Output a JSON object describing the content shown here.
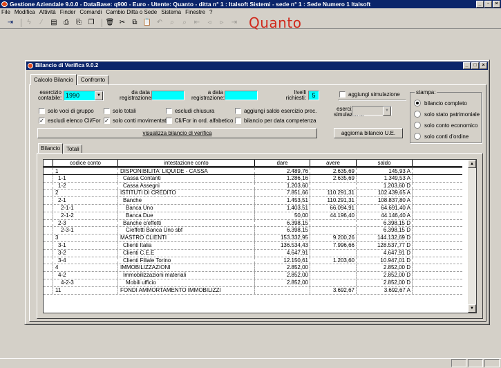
{
  "app": {
    "title": "Gestione Aziendale 9.0.0 - DataBase: q900 - Euro - Utente: Quanto - ditta n° 1 : Italsoft Sistemi - sede n° 1 : Sede Numero 1 Italsoft",
    "brand": "Quanto"
  },
  "menu": [
    "File",
    "Modifica",
    "Attività",
    "Finder",
    "Comandi",
    "Cambio Ditta o Sede",
    "Sistema",
    "Finestre",
    "?"
  ],
  "window": {
    "title": "Bilancio di Verifica 9.0.2",
    "tabs": [
      "Calcolo Bilancio",
      "Confronto"
    ]
  },
  "form": {
    "esercizio_label": "esercizio contabile:",
    "esercizio_value": "1990",
    "da_data_label": "da data registrazione:",
    "a_data_label": "a data registrazione:",
    "livelli_label": "livelli richiesti:",
    "livelli_value": "5",
    "aggiungi_simulazione": "aggiungi simulazione",
    "esercizio_di_simulazione": "esercizio di simulazione:",
    "stampa_label": "stampa:",
    "checkboxes": {
      "solo_voci_gruppo": "solo voci di gruppo",
      "solo_totali": "solo totali",
      "escludi_chiusura": "escludi chiusura",
      "aggiungi_saldo": "aggiungi saldo esercizio prec.",
      "escludi_elenco": "escludi elenco Cli/For",
      "solo_conti_movimentati": "solo conti movimentati",
      "cli_for_alfabetico": "Cli/For in ord. alfabetico",
      "bilancio_data_competenza": "bilancio per data competenza"
    },
    "radio": [
      "bilancio completo",
      "solo stato patrimoniale",
      "solo conto economico",
      "solo conti d'ordine"
    ],
    "visualizza_button": "visualizza bilancio di verifica",
    "aggiorna_button": "aggiorna bilancio U.E."
  },
  "subtabs": [
    "Bilancio",
    "Totali"
  ],
  "grid": {
    "columns": [
      "codice conto",
      "intestazione conto",
      "dare",
      "avere",
      "saldo"
    ],
    "rows": [
      {
        "codice": "1",
        "intestazione": "DISPONIBILITA' LIQUIDE - CASSA",
        "dare": "2.489,76",
        "avere": "2.635,69",
        "saldo": "145,93 A"
      },
      {
        "codice": "1-1",
        "intestazione": "Cassa Contanti",
        "dare": "1.286,16",
        "avere": "2.635,69",
        "saldo": "1.349,53 A"
      },
      {
        "codice": "1-2",
        "intestazione": "Cassa Assegni",
        "dare": "1.203,60",
        "avere": "",
        "saldo": "1.203,60 D"
      },
      {
        "codice": "2",
        "intestazione": "ISTITUTI DI CREDITO",
        "dare": "7.851,66",
        "avere": "110.291,31",
        "saldo": "102.439,65 A"
      },
      {
        "codice": "2-1",
        "intestazione": "Banche",
        "dare": "1.453,51",
        "avere": "110.291,31",
        "saldo": "108.837,80 A"
      },
      {
        "codice": "2-1-1",
        "intestazione": "Banca Uno",
        "dare": "1.403,51",
        "avere": "66.094,91",
        "saldo": "64.691,40 A"
      },
      {
        "codice": "2-1-2",
        "intestazione": "Banca Due",
        "dare": "50,00",
        "avere": "44.196,40",
        "saldo": "44.146,40 A"
      },
      {
        "codice": "2-3",
        "intestazione": "Banche c/effetti",
        "dare": "6.398,15",
        "avere": "",
        "saldo": "6.398,15 D"
      },
      {
        "codice": "2-3-1",
        "intestazione": "C/effetti Banca Uno sbf",
        "dare": "6.398,15",
        "avere": "",
        "saldo": "6.398,15 D"
      },
      {
        "codice": "3",
        "intestazione": "MASTRO CLIENTI",
        "dare": "153.332,95",
        "avere": "9.200,26",
        "saldo": "144.132,69 D"
      },
      {
        "codice": "3-1",
        "intestazione": "Clienti Italia",
        "dare": "136.534,43",
        "avere": "7.996,66",
        "saldo": "128.537,77 D"
      },
      {
        "codice": "3-2",
        "intestazione": "Clienti C.E.E",
        "dare": "4.647,91",
        "avere": "",
        "saldo": "4.647,91 D"
      },
      {
        "codice": "3-4",
        "intestazione": "Clienti Filiale Torino",
        "dare": "12.150,61",
        "avere": "1.203,60",
        "saldo": "10.947,01 D"
      },
      {
        "codice": "4",
        "intestazione": "IMMOBILIZZAZIONI",
        "dare": "2.852,00",
        "avere": "",
        "saldo": "2.852,00 D"
      },
      {
        "codice": "4-2",
        "intestazione": "Immobilizzazioni materiali",
        "dare": "2.852,00",
        "avere": "",
        "saldo": "2.852,00 D"
      },
      {
        "codice": "4-2-3",
        "intestazione": "Mobili ufficio",
        "dare": "2.852,00",
        "avere": "",
        "saldo": "2.852,00 D"
      },
      {
        "codice": "11",
        "intestazione": "FONDI AMMORTAMENTO IMMOBILIZZI",
        "dare": "",
        "avere": "3.692,67",
        "saldo": "3.692,67 A"
      }
    ]
  },
  "icons": [
    "exit-icon",
    "lightning-icon",
    "wand-icon",
    "preview-icon",
    "print-icon",
    "print-setup-icon",
    "copy-doc-icon",
    "delete-icon",
    "cut-icon",
    "copy-icon",
    "paste-icon",
    "undo-icon",
    "find-icon",
    "find-next-icon",
    "first-icon",
    "prev-icon",
    "next-icon",
    "last-icon"
  ]
}
